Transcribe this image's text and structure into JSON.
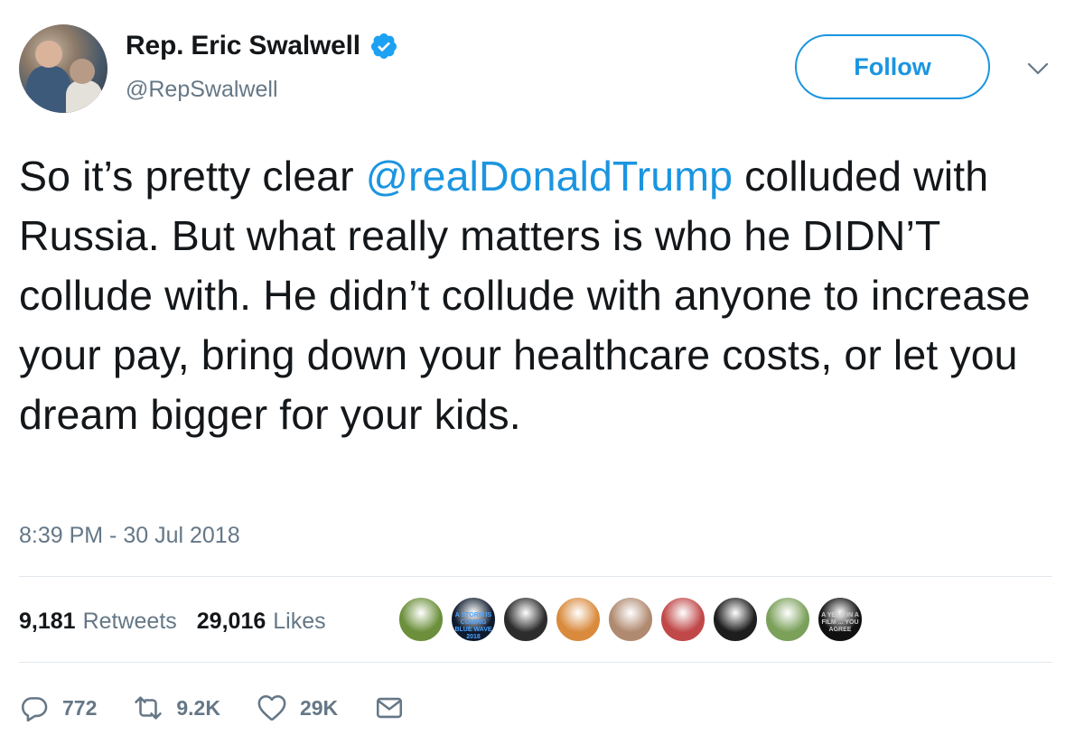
{
  "author": {
    "name": "Rep. Eric Swalwell",
    "handle": "@RepSwalwell"
  },
  "follow_label": "Follow",
  "tweet": {
    "text_before": "So it’s pretty clear ",
    "mention": "@realDonaldTrump",
    "text_after": " colluded with Russia. But what really matters is who he DIDN’T collude with. He didn’t collude with anyone to increase your pay, bring down your healthcare costs, or let you dream bigger for your kids.",
    "timestamp": "8:39 PM - 30 Jul 2018"
  },
  "stats": {
    "retweets_count": "9,181",
    "retweets_label": "Retweets",
    "likes_count": "29,016",
    "likes_label": "Likes"
  },
  "liker_avatars": [
    {
      "color": "#6b8f3a"
    },
    {
      "color": "#0e1a2e",
      "text": "A STORM IS COMING BLUE WAVE 2018"
    },
    {
      "color": "#2c2c2c"
    },
    {
      "color": "#d98a3d"
    },
    {
      "color": "#b08a70"
    },
    {
      "color": "#c04848"
    },
    {
      "color": "#1e1e1e"
    },
    {
      "color": "#7aa05a"
    },
    {
      "color": "#101010",
      "text": "A YEAR IN A FILM ... YOU AGREE"
    }
  ],
  "actions": {
    "reply_count": "772",
    "retweet_count": "9.2K",
    "like_count": "29K"
  },
  "colors": {
    "accent": "#1b95e0",
    "secondary_text": "#657786",
    "divider": "#e1e8ed"
  }
}
